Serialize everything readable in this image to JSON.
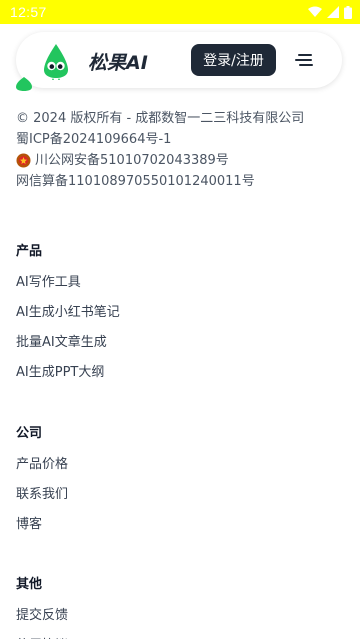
{
  "status_bar": {
    "time": "12:57"
  },
  "header": {
    "brand_name": "松果AI",
    "login_label": "登录/注册"
  },
  "footer_info": {
    "copyright": "© 2024 版权所有 - 成都数智一二三科技有限公司",
    "icp": "蜀ICP备2024109664号-1",
    "police": "川公网安备51010702043389号",
    "algorithm": "网信算备110108970550101240011号"
  },
  "sections": [
    {
      "title": "产品",
      "links": [
        "AI写作工具",
        "AI生成小红书笔记",
        "批量AI文章生成",
        "AI生成PPT大纲"
      ]
    },
    {
      "title": "公司",
      "links": [
        "产品价格",
        "联系我们",
        "博客"
      ]
    },
    {
      "title": "其他",
      "links": [
        "提交反馈",
        "使用协议"
      ]
    }
  ],
  "colors": {
    "status_bar": "#ffff00",
    "brand_green": "#22c55e",
    "button_dark": "#1f2937"
  }
}
